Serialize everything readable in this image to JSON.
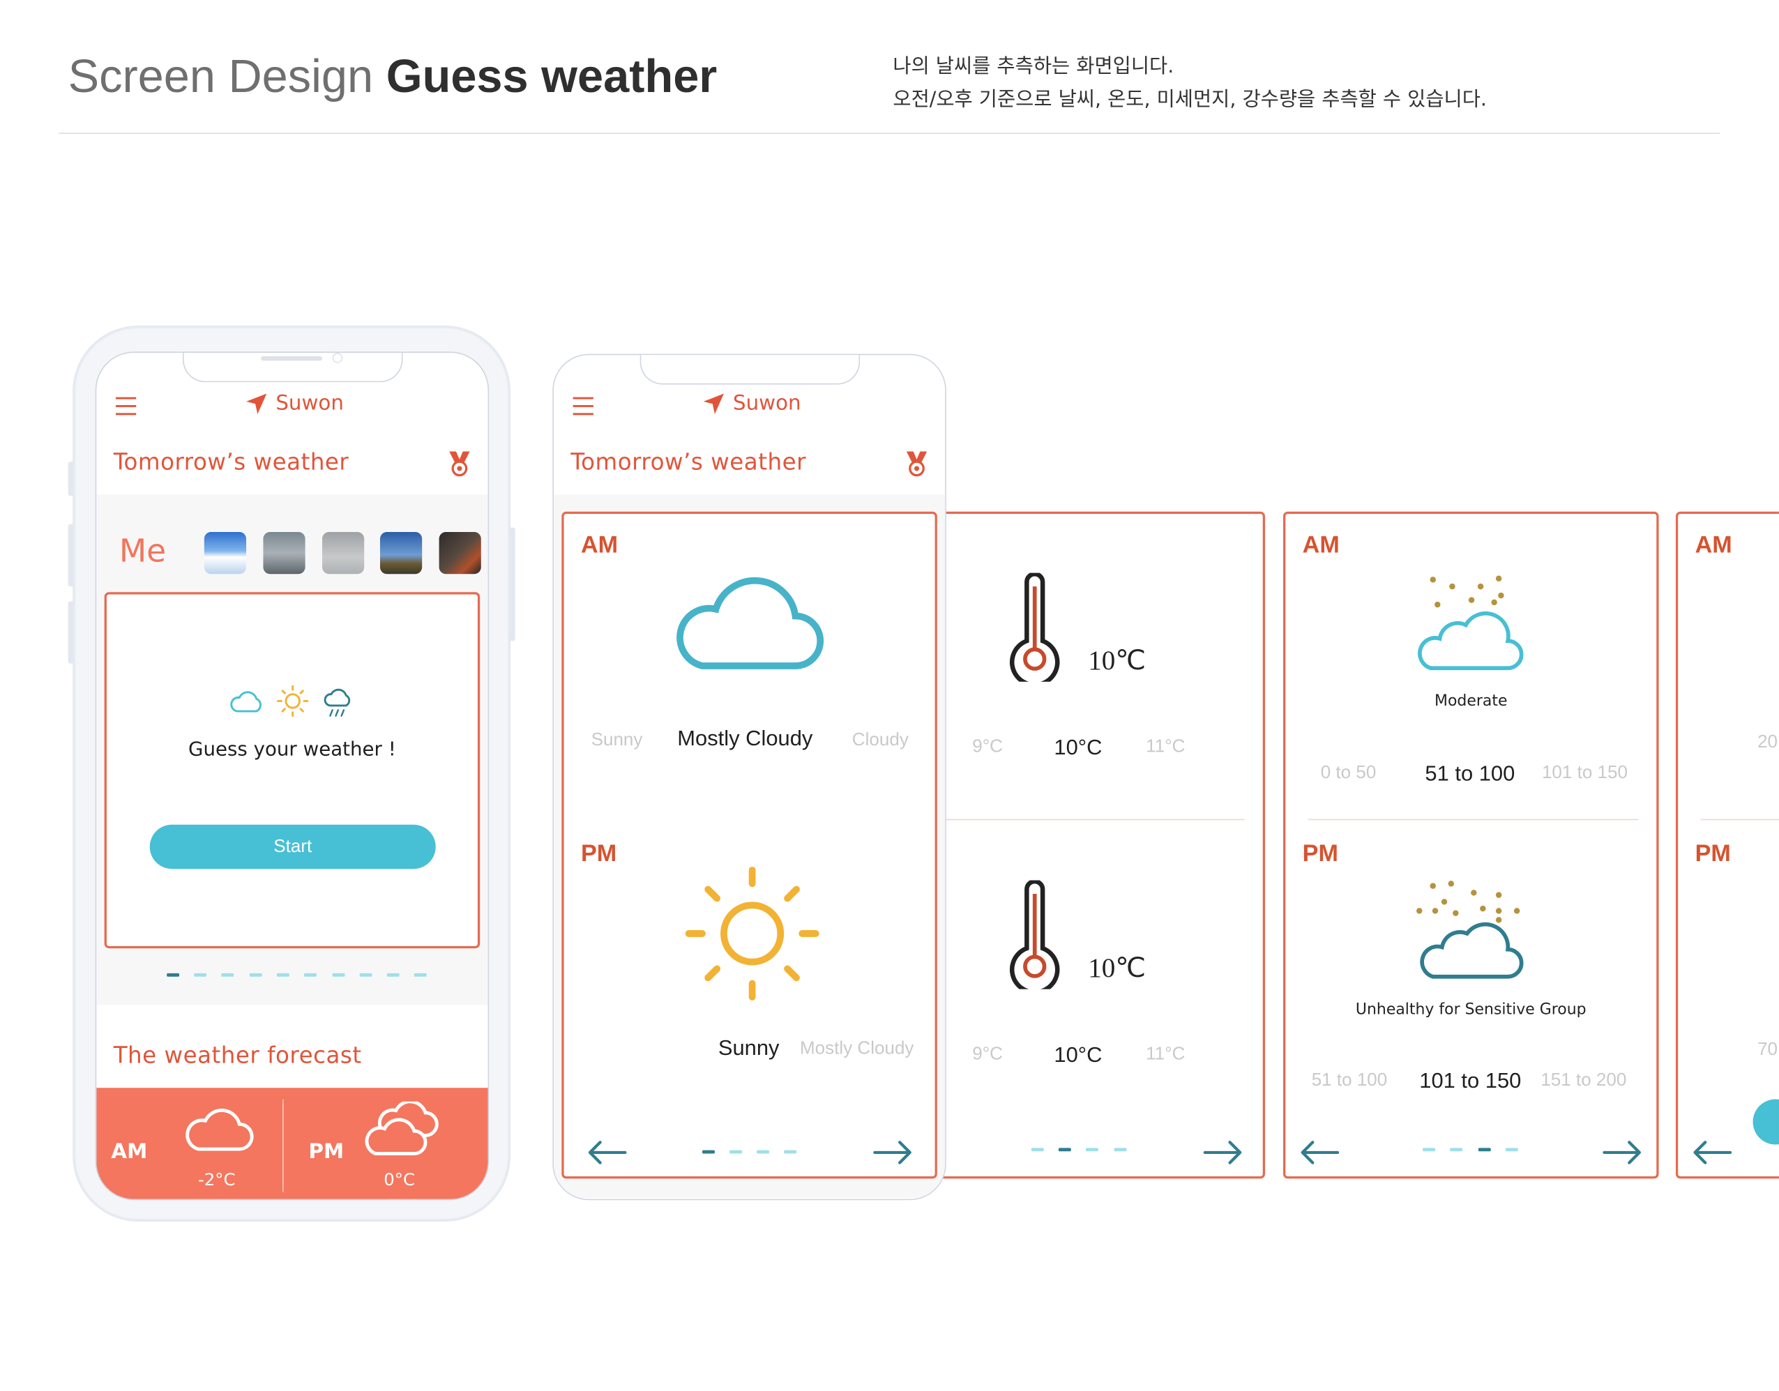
{
  "header": {
    "title_light": "Screen Design",
    "title_bold": "Guess weather",
    "desc_line1": "나의 날씨를 추측하는 화면입니다.",
    "desc_line2": "오전/오후 기준으로 날씨, 온도, 미세먼지, 강수량을 추측할 수 있습니다."
  },
  "phone1": {
    "location": "Suwon",
    "section_title": "Tomorrow’s weather",
    "me_label": "Me",
    "card_text": "Guess your weather !",
    "start_label": "Start",
    "forecast_title": "The weather forecast",
    "forecast": {
      "am_label": "AM",
      "am_temp": "-2°C",
      "pm_label": "PM",
      "pm_temp": "0°C"
    }
  },
  "phone2": {
    "location": "Suwon",
    "section_title": "Tomorrow’s weather",
    "am_label": "AM",
    "pm_label": "PM",
    "am_options": [
      "Sunny",
      "Mostly Cloudy",
      "Cloudy"
    ],
    "pm_options": [
      "Sunny",
      "Mostly Cloudy"
    ]
  },
  "temp_card": {
    "am_value": "10℃",
    "pm_value": "10℃",
    "am_options": [
      "9°C",
      "10°C",
      "11°C"
    ],
    "pm_options": [
      "9°C",
      "10°C",
      "11°C"
    ]
  },
  "dust_card": {
    "am_label": "AM",
    "pm_label": "PM",
    "am_status": "Moderate",
    "pm_status": "Unhealthy for Sensitive Group",
    "am_options": [
      "0 to 50",
      "51 to 100",
      "101 to 150"
    ],
    "pm_options": [
      "51 to 100",
      "101 to 150",
      "151 to 200"
    ]
  },
  "edge_card": {
    "am_label": "AM",
    "pm_label": "PM",
    "am_value": "20",
    "pm_value": "70"
  },
  "colors": {
    "accent": "#e0553a",
    "teal": "#47bfd4",
    "forecast_bg": "#f4765e",
    "arrow": "#2f7d8f"
  }
}
